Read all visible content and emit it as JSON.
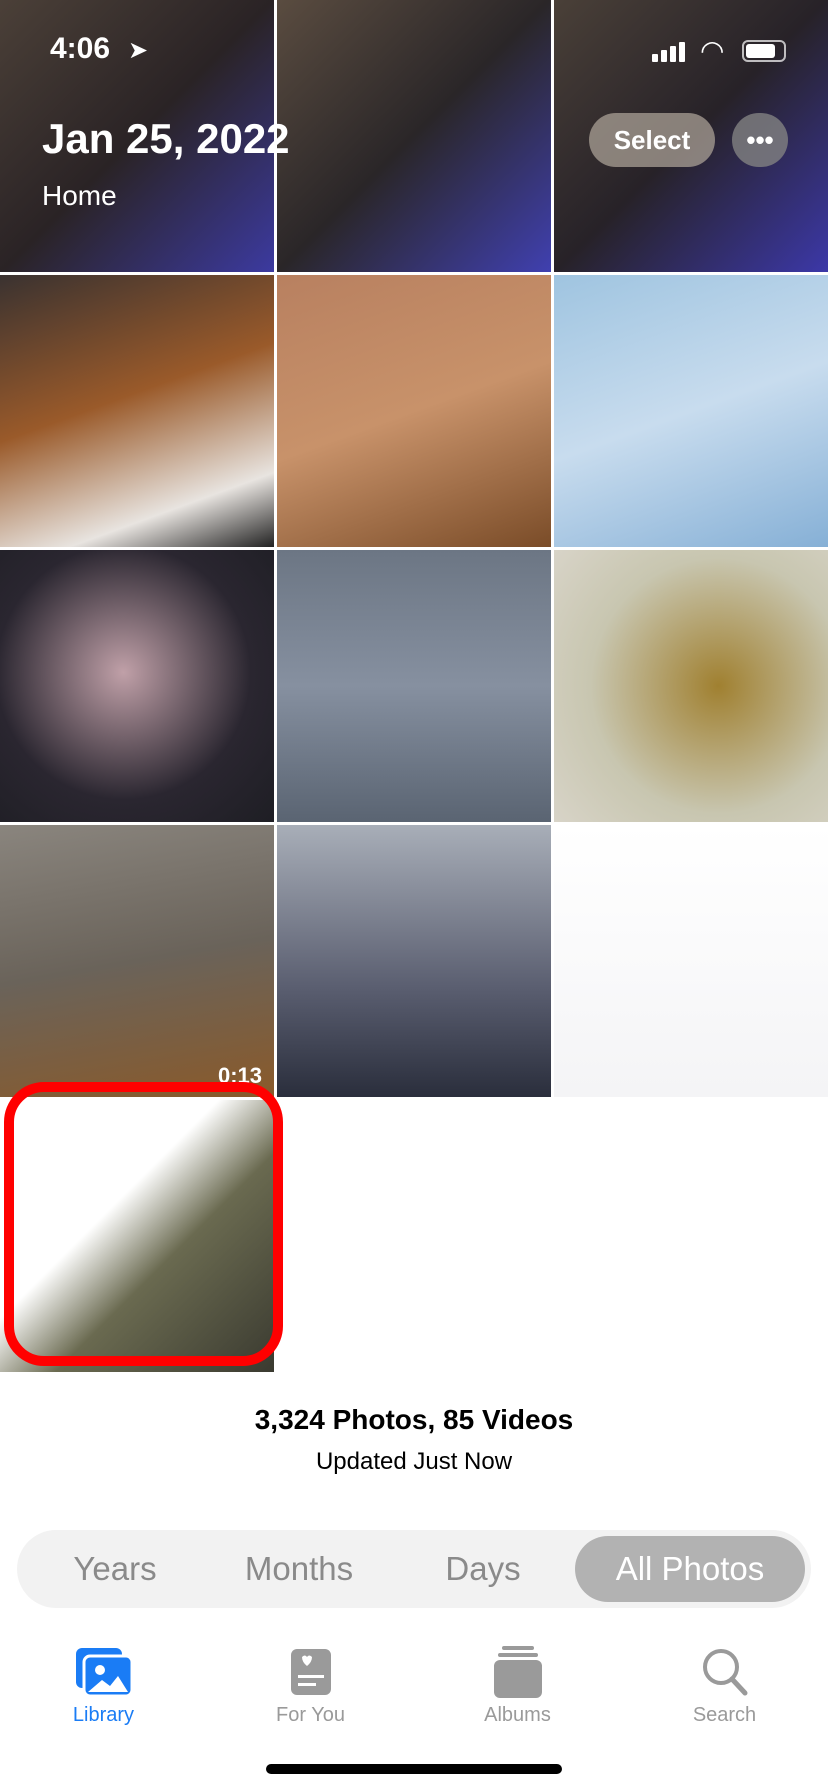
{
  "status_bar": {
    "time": "4:06"
  },
  "header": {
    "date": "Jan 25, 2022",
    "location": "Home",
    "select_label": "Select",
    "more_label": "•••"
  },
  "photos": [
    {
      "kind": "photo",
      "bg": "linear-gradient(135deg,#4b4038,#2a2325 50%,#3c3aa0)"
    },
    {
      "kind": "photo",
      "bg": "linear-gradient(135deg,#5a4c40,#2a2628 50%,#4040b0)"
    },
    {
      "kind": "photo",
      "bg": "linear-gradient(135deg,#4a4038,#272228 50%,#3c38a8)"
    },
    {
      "kind": "photo",
      "bg": "linear-gradient(160deg,#3a3230,#9a5a2a 45%,#e8e4e0 80%,#222)"
    },
    {
      "kind": "photo",
      "bg": "linear-gradient(160deg,#b88060,#c8926a 50%,#7a4c28)"
    },
    {
      "kind": "photo",
      "bg": "linear-gradient(160deg,#9fc4e0,#c8dcee 50%,#86b0d6)"
    },
    {
      "kind": "photo",
      "bg": "radial-gradient(circle at 45% 45%,#c0a0a8,#2a2630 60%,#1e1e24)"
    },
    {
      "kind": "photo",
      "bg": "linear-gradient(180deg,#6c7684,#8690a0 50%,#5a6472)"
    },
    {
      "kind": "photo",
      "bg": "radial-gradient(circle at 60% 50%,#a08030,#c8c6b0 60%,#d8d4c8)"
    },
    {
      "kind": "video",
      "duration": "0:13",
      "bg": "linear-gradient(170deg,#8a857e,#6a635a 50%,#8a5a2a)"
    },
    {
      "kind": "photo",
      "bg": "linear-gradient(180deg,#a8aeb8,#5a5e70 60%,#2a2e3c)"
    },
    {
      "kind": "photo",
      "bg": "linear-gradient(180deg,#ffffff,#f4f4f6)"
    },
    {
      "kind": "photo",
      "bg": "linear-gradient(135deg,#ffffff 40%,#6a6a50 60%,#3a3a30)"
    }
  ],
  "library": {
    "stats": "3,324 Photos, 85 Videos",
    "updated": "Updated Just Now"
  },
  "segments": [
    {
      "label": "Years"
    },
    {
      "label": "Months"
    },
    {
      "label": "Days"
    },
    {
      "label": "All Photos",
      "active": true
    }
  ],
  "tabs": [
    {
      "label": "Library",
      "icon": "photo-library-icon",
      "active": true
    },
    {
      "label": "For You",
      "icon": "for-you-icon"
    },
    {
      "label": "Albums",
      "icon": "albums-icon"
    },
    {
      "label": "Search",
      "icon": "search-icon"
    }
  ],
  "colors": {
    "accent": "#1a7cf5",
    "highlight": "#ff0000"
  }
}
